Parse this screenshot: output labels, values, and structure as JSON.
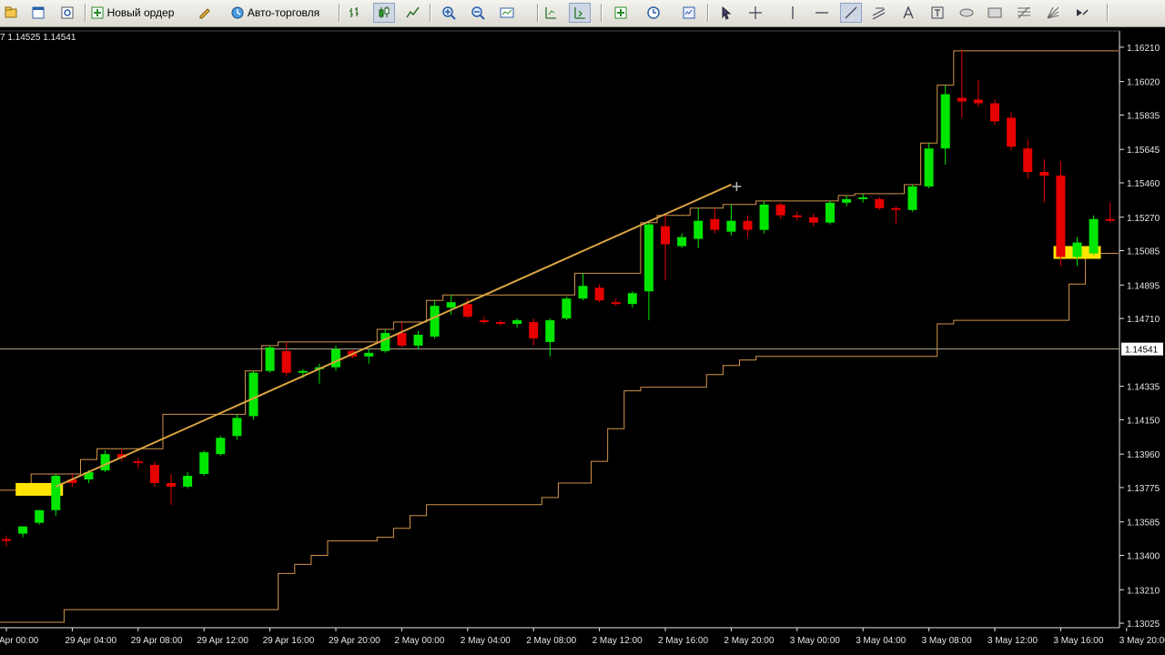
{
  "toolbar": {
    "new_order_label": "Новый ордер",
    "auto_trading_label": "Авто-торговля",
    "buttons": [
      {
        "icon": "profiles-icon"
      },
      {
        "icon": "window-icon"
      },
      {
        "icon": "data-window-icon"
      },
      {
        "icon": "new-order-icon"
      },
      {
        "icon": "metaeditor-icon"
      },
      {
        "icon": "auto-trading-icon"
      },
      {
        "icon": "bar-chart-icon"
      },
      {
        "icon": "candlestick-icon",
        "pressed": true
      },
      {
        "icon": "line-chart-icon"
      },
      {
        "icon": "zoom-in-icon"
      },
      {
        "icon": "zoom-out-icon"
      },
      {
        "icon": "tile-windows-icon"
      },
      {
        "icon": "chart-shift-icon"
      },
      {
        "icon": "autoscroll-icon",
        "pressed": true
      },
      {
        "icon": "indicators-icon"
      },
      {
        "icon": "periods-icon"
      },
      {
        "icon": "templates-icon"
      },
      {
        "icon": "cursor-icon"
      },
      {
        "icon": "crosshair-icon"
      },
      {
        "icon": "vertical-line-icon"
      },
      {
        "icon": "horizontal-line-icon"
      },
      {
        "icon": "trendline-icon",
        "pressed": true
      },
      {
        "icon": "equidistant-channel-icon"
      },
      {
        "icon": "text-icon"
      },
      {
        "icon": "text-label-icon"
      },
      {
        "icon": "ellipse-icon"
      },
      {
        "icon": "rectangle-icon"
      },
      {
        "icon": "fibonacci-icon"
      },
      {
        "icon": "gann-fan-icon"
      },
      {
        "icon": "arrows-icon"
      }
    ]
  },
  "chart_header": {
    "ohlc_text": "7 1.14525 1.14541"
  },
  "colors": {
    "background": "#000000",
    "bull": "#00e600",
    "bear": "#e60000",
    "channel": "#d2954b",
    "trendline": "#d9a441",
    "highlight": "#ffe400",
    "bid_line": "#b7a793",
    "axis_text": "#e6e6e6"
  },
  "price_axis": {
    "labels": [
      "1.16210",
      "1.16020",
      "1.15835",
      "1.15645",
      "1.15460",
      "1.15270",
      "1.15085",
      "1.14895",
      "1.14710",
      "1.14335",
      "1.14150",
      "1.13960",
      "1.13775",
      "1.13585",
      "1.13400",
      "1.13210",
      "1.13025"
    ],
    "current_price": "1.14541"
  },
  "time_axis": {
    "labels": [
      "Apr 00:00",
      "29 Apr 04:00",
      "29 Apr 08:00",
      "29 Apr 12:00",
      "29 Apr 16:00",
      "29 Apr 20:00",
      "2 May 00:00",
      "2 May 04:00",
      "2 May 08:00",
      "2 May 12:00",
      "2 May 16:00",
      "2 May 20:00",
      "3 May 00:00",
      "3 May 04:00",
      "3 May 08:00",
      "3 May 12:00",
      "3 May 16:00",
      "3 May 20:00"
    ]
  },
  "chart_data": {
    "type": "candlestick",
    "y_range": [
      1.13,
      1.163
    ],
    "candles": [
      {
        "o": 1.1349,
        "h": 1.1351,
        "l": 1.1345,
        "c": 1.1348
      },
      {
        "o": 1.1352,
        "h": 1.1356,
        "l": 1.135,
        "c": 1.1356
      },
      {
        "o": 1.1358,
        "h": 1.1365,
        "l": 1.1357,
        "c": 1.1365
      },
      {
        "o": 1.1365,
        "h": 1.1385,
        "l": 1.1362,
        "c": 1.1384
      },
      {
        "o": 1.1382,
        "h": 1.1385,
        "l": 1.1378,
        "c": 1.138
      },
      {
        "o": 1.1382,
        "h": 1.1387,
        "l": 1.138,
        "c": 1.1386
      },
      {
        "o": 1.1387,
        "h": 1.1398,
        "l": 1.1386,
        "c": 1.1396
      },
      {
        "o": 1.1396,
        "h": 1.1399,
        "l": 1.1392,
        "c": 1.1394
      },
      {
        "o": 1.1392,
        "h": 1.1394,
        "l": 1.1388,
        "c": 1.1391
      },
      {
        "o": 1.139,
        "h": 1.1392,
        "l": 1.1378,
        "c": 1.138
      },
      {
        "o": 1.138,
        "h": 1.1385,
        "l": 1.1368,
        "c": 1.1378
      },
      {
        "o": 1.1378,
        "h": 1.1386,
        "l": 1.1377,
        "c": 1.1384
      },
      {
        "o": 1.1385,
        "h": 1.1398,
        "l": 1.1384,
        "c": 1.1397
      },
      {
        "o": 1.1396,
        "h": 1.1406,
        "l": 1.1395,
        "c": 1.1405
      },
      {
        "o": 1.1406,
        "h": 1.1418,
        "l": 1.1404,
        "c": 1.1416
      },
      {
        "o": 1.1417,
        "h": 1.1442,
        "l": 1.1415,
        "c": 1.1441
      },
      {
        "o": 1.1442,
        "h": 1.1456,
        "l": 1.1441,
        "c": 1.1455
      },
      {
        "o": 1.1453,
        "h": 1.1458,
        "l": 1.1439,
        "c": 1.1441
      },
      {
        "o": 1.1441,
        "h": 1.1443,
        "l": 1.1438,
        "c": 1.1442
      },
      {
        "o": 1.1443,
        "h": 1.1446,
        "l": 1.1435,
        "c": 1.1444
      },
      {
        "o": 1.1444,
        "h": 1.1456,
        "l": 1.1442,
        "c": 1.1454
      },
      {
        "o": 1.1453,
        "h": 1.1454,
        "l": 1.1449,
        "c": 1.145
      },
      {
        "o": 1.145,
        "h": 1.1454,
        "l": 1.1446,
        "c": 1.1452
      },
      {
        "o": 1.1453,
        "h": 1.1465,
        "l": 1.1452,
        "c": 1.1463
      },
      {
        "o": 1.1463,
        "h": 1.1469,
        "l": 1.1455,
        "c": 1.1456
      },
      {
        "o": 1.1456,
        "h": 1.1464,
        "l": 1.1454,
        "c": 1.1462
      },
      {
        "o": 1.1461,
        "h": 1.1481,
        "l": 1.146,
        "c": 1.1478
      },
      {
        "o": 1.1477,
        "h": 1.1484,
        "l": 1.1473,
        "c": 1.148
      },
      {
        "o": 1.1479,
        "h": 1.1482,
        "l": 1.1471,
        "c": 1.1472
      },
      {
        "o": 1.147,
        "h": 1.1472,
        "l": 1.1468,
        "c": 1.1469
      },
      {
        "o": 1.1469,
        "h": 1.147,
        "l": 1.1467,
        "c": 1.1468
      },
      {
        "o": 1.1468,
        "h": 1.1471,
        "l": 1.1466,
        "c": 1.147
      },
      {
        "o": 1.1469,
        "h": 1.1471,
        "l": 1.1456,
        "c": 1.146
      },
      {
        "o": 1.1458,
        "h": 1.1471,
        "l": 1.145,
        "c": 1.147
      },
      {
        "o": 1.1471,
        "h": 1.1483,
        "l": 1.147,
        "c": 1.1482
      },
      {
        "o": 1.1482,
        "h": 1.1496,
        "l": 1.1481,
        "c": 1.1489
      },
      {
        "o": 1.1488,
        "h": 1.149,
        "l": 1.148,
        "c": 1.1481
      },
      {
        "o": 1.148,
        "h": 1.1482,
        "l": 1.1478,
        "c": 1.1479
      },
      {
        "o": 1.1479,
        "h": 1.1486,
        "l": 1.1477,
        "c": 1.1485
      },
      {
        "o": 1.1486,
        "h": 1.1524,
        "l": 1.147,
        "c": 1.1523
      },
      {
        "o": 1.1522,
        "h": 1.1528,
        "l": 1.1492,
        "c": 1.1512
      },
      {
        "o": 1.1511,
        "h": 1.1518,
        "l": 1.151,
        "c": 1.1516
      },
      {
        "o": 1.1515,
        "h": 1.1532,
        "l": 1.151,
        "c": 1.1525
      },
      {
        "o": 1.1526,
        "h": 1.1532,
        "l": 1.1518,
        "c": 1.152
      },
      {
        "o": 1.1519,
        "h": 1.1534,
        "l": 1.1517,
        "c": 1.1525
      },
      {
        "o": 1.1525,
        "h": 1.1528,
        "l": 1.1516,
        "c": 1.152
      },
      {
        "o": 1.152,
        "h": 1.1536,
        "l": 1.1518,
        "c": 1.1534
      },
      {
        "o": 1.1534,
        "h": 1.1535,
        "l": 1.1526,
        "c": 1.1528
      },
      {
        "o": 1.1528,
        "h": 1.153,
        "l": 1.1525,
        "c": 1.1527
      },
      {
        "o": 1.1527,
        "h": 1.1529,
        "l": 1.1522,
        "c": 1.1524
      },
      {
        "o": 1.1524,
        "h": 1.1536,
        "l": 1.1523,
        "c": 1.1535
      },
      {
        "o": 1.1535,
        "h": 1.1539,
        "l": 1.1533,
        "c": 1.1537
      },
      {
        "o": 1.1537,
        "h": 1.154,
        "l": 1.1535,
        "c": 1.1538
      },
      {
        "o": 1.1537,
        "h": 1.1538,
        "l": 1.1531,
        "c": 1.1532
      },
      {
        "o": 1.1532,
        "h": 1.1533,
        "l": 1.1523,
        "c": 1.1531
      },
      {
        "o": 1.1531,
        "h": 1.1545,
        "l": 1.153,
        "c": 1.1544
      },
      {
        "o": 1.1544,
        "h": 1.1568,
        "l": 1.1543,
        "c": 1.1565
      },
      {
        "o": 1.1565,
        "h": 1.16,
        "l": 1.1556,
        "c": 1.1595
      },
      {
        "o": 1.1593,
        "h": 1.1619,
        "l": 1.1582,
        "c": 1.1591
      },
      {
        "o": 1.1592,
        "h": 1.1603,
        "l": 1.1588,
        "c": 1.159
      },
      {
        "o": 1.159,
        "h": 1.1592,
        "l": 1.1578,
        "c": 1.158
      },
      {
        "o": 1.1582,
        "h": 1.1585,
        "l": 1.1564,
        "c": 1.1566
      },
      {
        "o": 1.1565,
        "h": 1.157,
        "l": 1.1548,
        "c": 1.1552
      },
      {
        "o": 1.1552,
        "h": 1.1559,
        "l": 1.1535,
        "c": 1.155
      },
      {
        "o": 1.155,
        "h": 1.1558,
        "l": 1.15,
        "c": 1.1505
      },
      {
        "o": 1.1505,
        "h": 1.1516,
        "l": 1.15,
        "c": 1.1513
      },
      {
        "o": 1.1507,
        "h": 1.1528,
        "l": 1.1506,
        "c": 1.1526
      },
      {
        "o": 1.1526,
        "h": 1.1535,
        "l": 1.1524,
        "c": 1.1525
      }
    ],
    "channel_upper": [
      1.1376,
      1.1376,
      1.1385,
      1.1385,
      1.1385,
      1.1393,
      1.1399,
      1.1399,
      1.1399,
      1.1399,
      1.1418,
      1.1418,
      1.1418,
      1.1418,
      1.1418,
      1.1442,
      1.1456,
      1.1458,
      1.1458,
      1.1458,
      1.1458,
      1.1458,
      1.1458,
      1.1465,
      1.1469,
      1.1469,
      1.1481,
      1.1484,
      1.1484,
      1.1484,
      1.1484,
      1.1484,
      1.1484,
      1.1484,
      1.1484,
      1.1496,
      1.1496,
      1.1496,
      1.1496,
      1.1524,
      1.1528,
      1.1528,
      1.1532,
      1.1532,
      1.1534,
      1.1534,
      1.1536,
      1.1536,
      1.1536,
      1.1536,
      1.1536,
      1.1539,
      1.154,
      1.154,
      1.154,
      1.1545,
      1.1568,
      1.16,
      1.1619,
      1.1619,
      1.1619,
      1.1619,
      1.1619,
      1.1619,
      1.1619,
      1.1619,
      1.1619,
      1.1619
    ],
    "channel_lower": [
      1.1303,
      1.1303,
      1.1303,
      1.1303,
      1.131,
      1.131,
      1.131,
      1.131,
      1.131,
      1.131,
      1.131,
      1.131,
      1.131,
      1.131,
      1.131,
      1.131,
      1.131,
      1.133,
      1.1335,
      1.134,
      1.1348,
      1.1348,
      1.1348,
      1.135,
      1.1355,
      1.1362,
      1.1368,
      1.1368,
      1.1368,
      1.1368,
      1.1368,
      1.1368,
      1.1368,
      1.1372,
      1.138,
      1.138,
      1.1392,
      1.141,
      1.1431,
      1.1433,
      1.1433,
      1.1433,
      1.1433,
      1.144,
      1.1445,
      1.1448,
      1.145,
      1.145,
      1.145,
      1.145,
      1.145,
      1.145,
      1.145,
      1.145,
      1.145,
      1.145,
      1.145,
      1.1468,
      1.147,
      1.147,
      1.147,
      1.147,
      1.147,
      1.147,
      1.147,
      1.149,
      1.1507,
      1.1507
    ],
    "trendline": {
      "from": {
        "x": 3,
        "y": 1.1378
      },
      "to": {
        "x": 44,
        "y": 1.1545
      }
    },
    "highlights": [
      {
        "x": 2,
        "y": 1.1376
      },
      {
        "x": 65,
        "y": 1.1507
      }
    ],
    "bid_line": 1.14541
  }
}
